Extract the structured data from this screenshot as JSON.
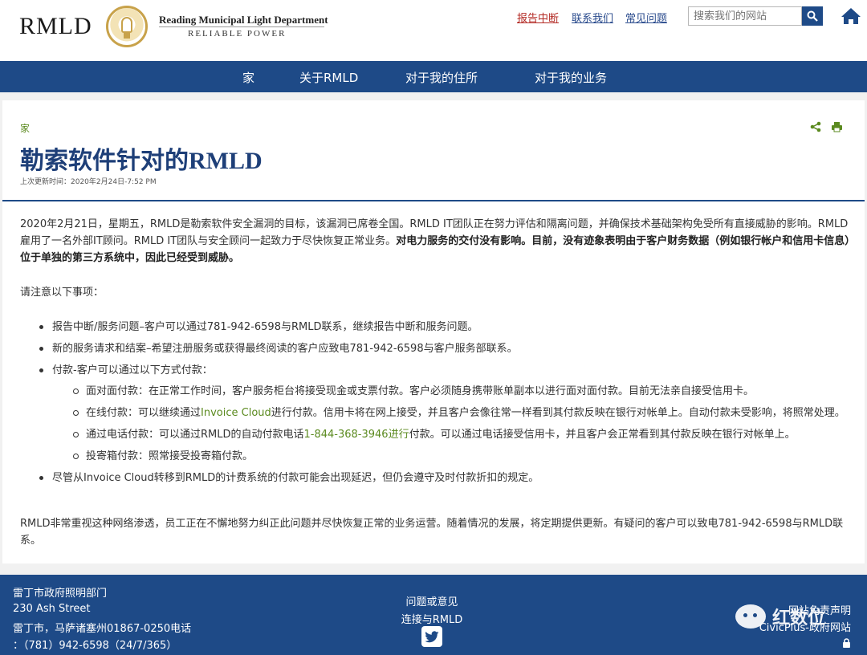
{
  "header": {
    "logo": "RMLD",
    "org_name": "Reading Municipal Light Department",
    "tagline": "RELIABLE POWER",
    "links": [
      "报告中断",
      "联系我们",
      "常见问题"
    ],
    "search_placeholder": "搜索我们的网站",
    "colors": {
      "brand_blue": "#1e4a87",
      "alert_red": "#b32a24",
      "link_green": "#5b8a1f"
    }
  },
  "nav": {
    "items": [
      "家",
      "关于RMLD",
      "对于我的住所",
      "对于我的业务"
    ]
  },
  "page": {
    "breadcrumb": "家",
    "title": "勒索软件针对的RMLD",
    "updated": "上次更新时间：2020年2月24日-7:52 PM",
    "intro_a": "2020年2月21日，星期五，RMLD是勒索软件安全漏洞的目标，该漏洞已席卷全国。RMLD IT团队正在努力评估和隔离问题，并确保技术基础架构免受所有直接威胁的影响。RMLD雇用了一名外部IT顾问。RMLD IT团队与安全顾问一起致力于尽快恢复正常业务。",
    "intro_b": "对电力服务的交付没有影响。目前，没有迹象表明由于客户财务数据（例如银行帐户和信用卡信息）位于单独的第三方系统中，因此已经受到威胁。",
    "notice": "请注意以下事项：",
    "bullets": [
      "报告中断/服务问题–客户可以通过781-942-6598与RMLD联系，继续报告中断和服务问题。",
      "新的服务请求和结案–希望注册服务或获得最终阅读的客户应致电781-942-6598与客户服务部联系。",
      "付款-客户可以通过以下方式付款：",
      "尽管从Invoice Cloud转移到RMLD的计费系统的付款可能会出现延迟，但仍会遵守及时付款折扣的规定。"
    ],
    "sub": {
      "in_person": "面对面付款：在正常工作时间，客户服务柜台将接受现金或支票付款。客户必须随身携带账单副本以进行面对面付款。目前无法亲自接受信用卡。",
      "online_a": "在线付款：可以继续通过",
      "online_link": "Invoice Cloud",
      "online_b": "进行付款。信用卡将在网上接受，并且客户会像往常一样看到其付款反映在银行对帐单上。自动付款未受影响，将照常处理。",
      "phone_a": "通过电话付款：可以通过RMLD的自动付款电话",
      "phone_link": "1-844-368-3946进行",
      "phone_b": "付款。可以通过电话接受信用卡，并且客户会正常看到其付款反映在银行对帐单上。",
      "dropbox": "投寄箱付款：照常接受投寄箱付款。"
    },
    "closing": "RMLD非常重视这种网络渗透，员工正在不懈地努力纠正此问题并尽快恢复正常的业务运营。随着情况的发展，将定期提供更新。有疑问的客户可以致电781-942-6598与RMLD联系。"
  },
  "footer": {
    "org": "雷丁市政府照明部门",
    "street": "230 Ash Street",
    "city": "雷丁市，马萨诸塞州01867-0250电话",
    "phone": "：（781）942-6598（24/7/365）",
    "questions": "问题或意见",
    "connect": "连接与RMLD",
    "legal": "网站免责声明",
    "credit": "CivicPlus-政府网站",
    "watermark": "红数位"
  }
}
